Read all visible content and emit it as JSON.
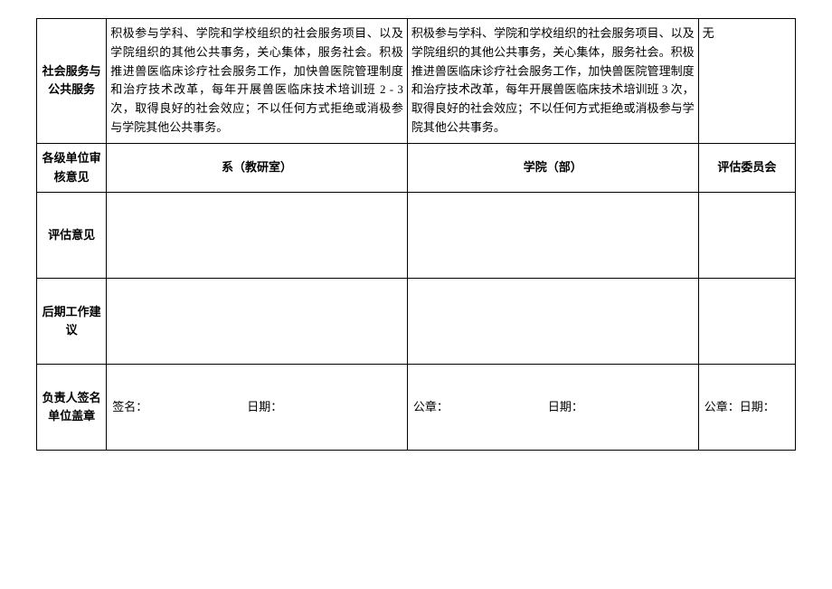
{
  "row1": {
    "label": "社会服务与公共服务",
    "col2": "积极参与学科、学院和学校组织的社会服务项目、以及学院组织的其他公共事务，关心集体，服务社会。积极推进兽医临床诊疗社会服务工作，加快兽医院管理制度和治疗技术改革，每年开展兽医临床技术培训班 2 - 3 次，取得良好的社会效应；不以任何方式拒绝或消极参与学院其他公共事务。",
    "col3": "积极参与学科、学院和学校组织的社会服务项目、以及学院组织的其他公共事务，关心集体，服务社会。积极推进兽医临床诊疗社会服务工作，加快兽医院管理制度和治疗技术改革，每年开展兽医临床技术培训班 3 次，取得良好的社会效应；不以任何方式拒绝或消极参与学院其他公共事务。",
    "col4": "无"
  },
  "headerRow": {
    "label": "各级单位审核意见",
    "col2": "系（教研室）",
    "col3": "学院（部）",
    "col4": "评估委员会"
  },
  "row3": {
    "label": "评估意见",
    "col2": "",
    "col3": "",
    "col4": ""
  },
  "row4": {
    "label": "后期工作建议",
    "col2": "",
    "col3": "",
    "col4": ""
  },
  "row5": {
    "label": "负责人签名单位盖章",
    "sig_label": "签名：",
    "date_label": "日期：",
    "seal_label": "公章：",
    "col4_text": "公章：日期："
  }
}
